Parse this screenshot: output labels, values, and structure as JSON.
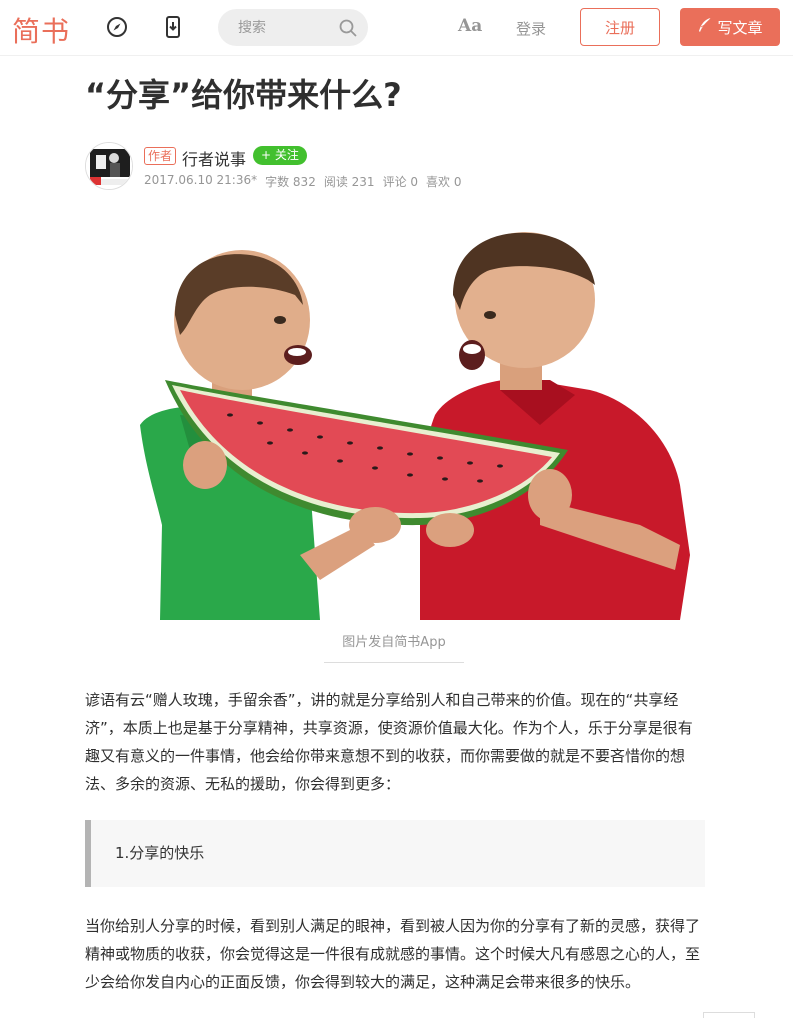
{
  "header": {
    "logo": "简书",
    "search_placeholder": "搜索",
    "font_toggle": "Aa",
    "login": "登录",
    "register": "注册",
    "write": "写文章"
  },
  "article": {
    "title": "“分享”给你带来什么?",
    "author_tag": "作者",
    "author_name": "行者说事",
    "follow": "+ 关注",
    "meta": {
      "date": "2017.06.10 21:36*",
      "words": "字数 832",
      "reads": "阅读 231",
      "comments": "评论 0",
      "likes": "喜欢 0"
    },
    "image_caption": "图片发自简书App",
    "paragraphs": [
      "谚语有云“赠人玫瑰，手留余香”，讲的就是分享给别人和自己带来的价值。现在的“共享经济”，本质上也是基于分享精神，共享资源，使资源价值最大化。作为个人，乐于分享是很有趣又有意义的一件事情，他会给你带来意想不到的收获，而你需要做的就是不要吝惜你的想法、多余的资源、无私的援助，你会得到更多：",
      "当你给别人分享的时候，看到别人满足的眼神，看到被人因为你的分享有了新的灵感，获得了精神或物质的收获，你会觉得这是一件很有成就感的事情。这个时候大凡有感恩之心的人，至少会给你发自内心的正面反馈，你会得到较大的满足，这种满足会带来很多的快乐。"
    ],
    "blockquote": "1.分享的快乐"
  },
  "colors": {
    "brand": "#ea6f5a",
    "follow_green": "#42c02e",
    "text": "#2f2f2f",
    "muted": "#969696"
  },
  "icons": [
    "compass-icon",
    "mobile-download-icon",
    "search-icon",
    "quill-icon"
  ]
}
